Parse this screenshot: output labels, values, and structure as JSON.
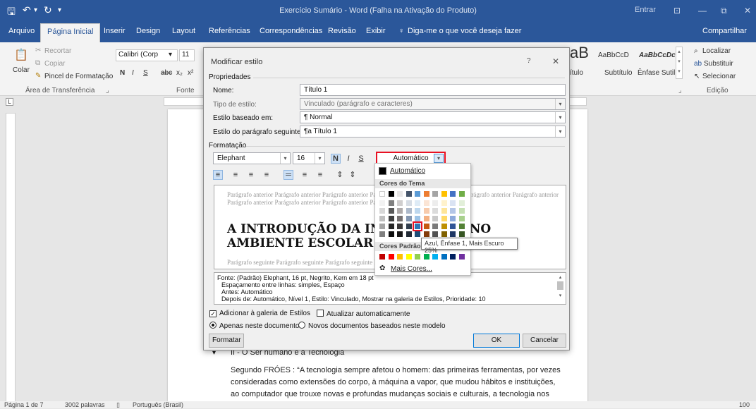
{
  "titlebar": {
    "title": "Exercício Sumário - Word (Falha na Ativação do Produto)",
    "signin": "Entrar"
  },
  "tabs": [
    "Arquivo",
    "Página Inicial",
    "Inserir",
    "Design",
    "Layout",
    "Referências",
    "Correspondências",
    "Revisão",
    "Exibir"
  ],
  "tell_me": "Diga-me o que você deseja fazer",
  "share": "Compartilhar",
  "clipboard": {
    "paste": "Colar",
    "cut": "Recortar",
    "copy": "Copiar",
    "format_painter": "Pincel de Formatação",
    "group": "Área de Transferência"
  },
  "font_group": {
    "font": "Calibri (Corp",
    "size": "11",
    "group": "Fonte"
  },
  "styles": {
    "s1": "AaBbCcD",
    "s2": "AaBbCcDc",
    "label1": "ítulo",
    "label2": "Subtítulo",
    "label3": "Ênfase Sutil",
    "big": "aB"
  },
  "editing": {
    "find": "Localizar",
    "replace": "Substituir",
    "select": "Selecionar",
    "group": "Edição"
  },
  "dialog": {
    "title": "Modificar estilo",
    "help": "?",
    "close": "✕",
    "properties": "Propriedades",
    "name_label": "Nome:",
    "name_value": "Título 1",
    "type_label": "Tipo de estilo:",
    "type_value": "Vinculado (parágrafo e caracteres)",
    "based_label": "Estilo baseado em:",
    "based_value": "¶ Normal",
    "next_label": "Estilo do parágrafo seguinte:",
    "next_value": "¶a Título 1",
    "formatting": "Formatação",
    "font": "Elephant",
    "size": "16",
    "bold": "N",
    "italic": "I",
    "underline": "S",
    "color": "Automático",
    "preview_before": "Parágrafo anterior Parágrafo anterior Parágrafo anterior Parágrafo anterior Parágrafo anterior Parágrafo anterior Parágrafo anterior Parágrafo anterior Parágrafo anterior Parágrafo anterior Parágrafo",
    "preview_heading1": "A INTRODUÇÃO DA INFORMÁTICA NO",
    "preview_heading2": "AMBIENTE ESCOLAR",
    "preview_after": "Parágrafo seguinte Parágrafo seguinte Parágrafo seguinte Parágrafo seguinte Parágrafo seguinte",
    "desc1": "Fonte: (Padrão) Elephant, 16 pt, Negrito, Kern em 18 pt",
    "desc2": "Espaçamento entre linhas:  simples, Espaço",
    "desc3": "Antes:  Automático",
    "desc4": "Depois de:  Automático, Nível 1, Estilo: Vinculado, Mostrar na galeria de Estilos, Prioridade: 10",
    "add_gallery": "Adicionar à galeria de Estilos",
    "auto_update": "Atualizar automaticamente",
    "only_doc": "Apenas neste documento",
    "new_docs": "Novos documentos baseados neste modelo",
    "format_btn": "Formatar ▾",
    "ok": "OK",
    "cancel": "Cancelar"
  },
  "palette": {
    "auto": "Automático",
    "theme": "Cores do Tema",
    "standard": "Cores Padrão",
    "more": "Mais Cores..."
  },
  "tooltip": "Azul, Ênfase 1, Mais Escuro 25%",
  "document": {
    "line1": "II - O Ser humano e a Tecnologia",
    "line2": "Segundo FRÓES : “A tecnologia sempre afetou o homem: das primeiras ferramentas, por vezes",
    "line3": "consideradas como extensões do corpo, à máquina a vapor, que mudou hábitos e instituições,",
    "line4": "ao computador que trouxe novas e profundas mudanças sociais e culturais, a tecnologia nos"
  },
  "status": {
    "page": "Página 1 de 7",
    "words": "3002 palavras",
    "lang": "Português (Brasil)",
    "zoom": "100"
  },
  "colors": {
    "accent": "#2b579a",
    "highlight": "#e81123"
  }
}
